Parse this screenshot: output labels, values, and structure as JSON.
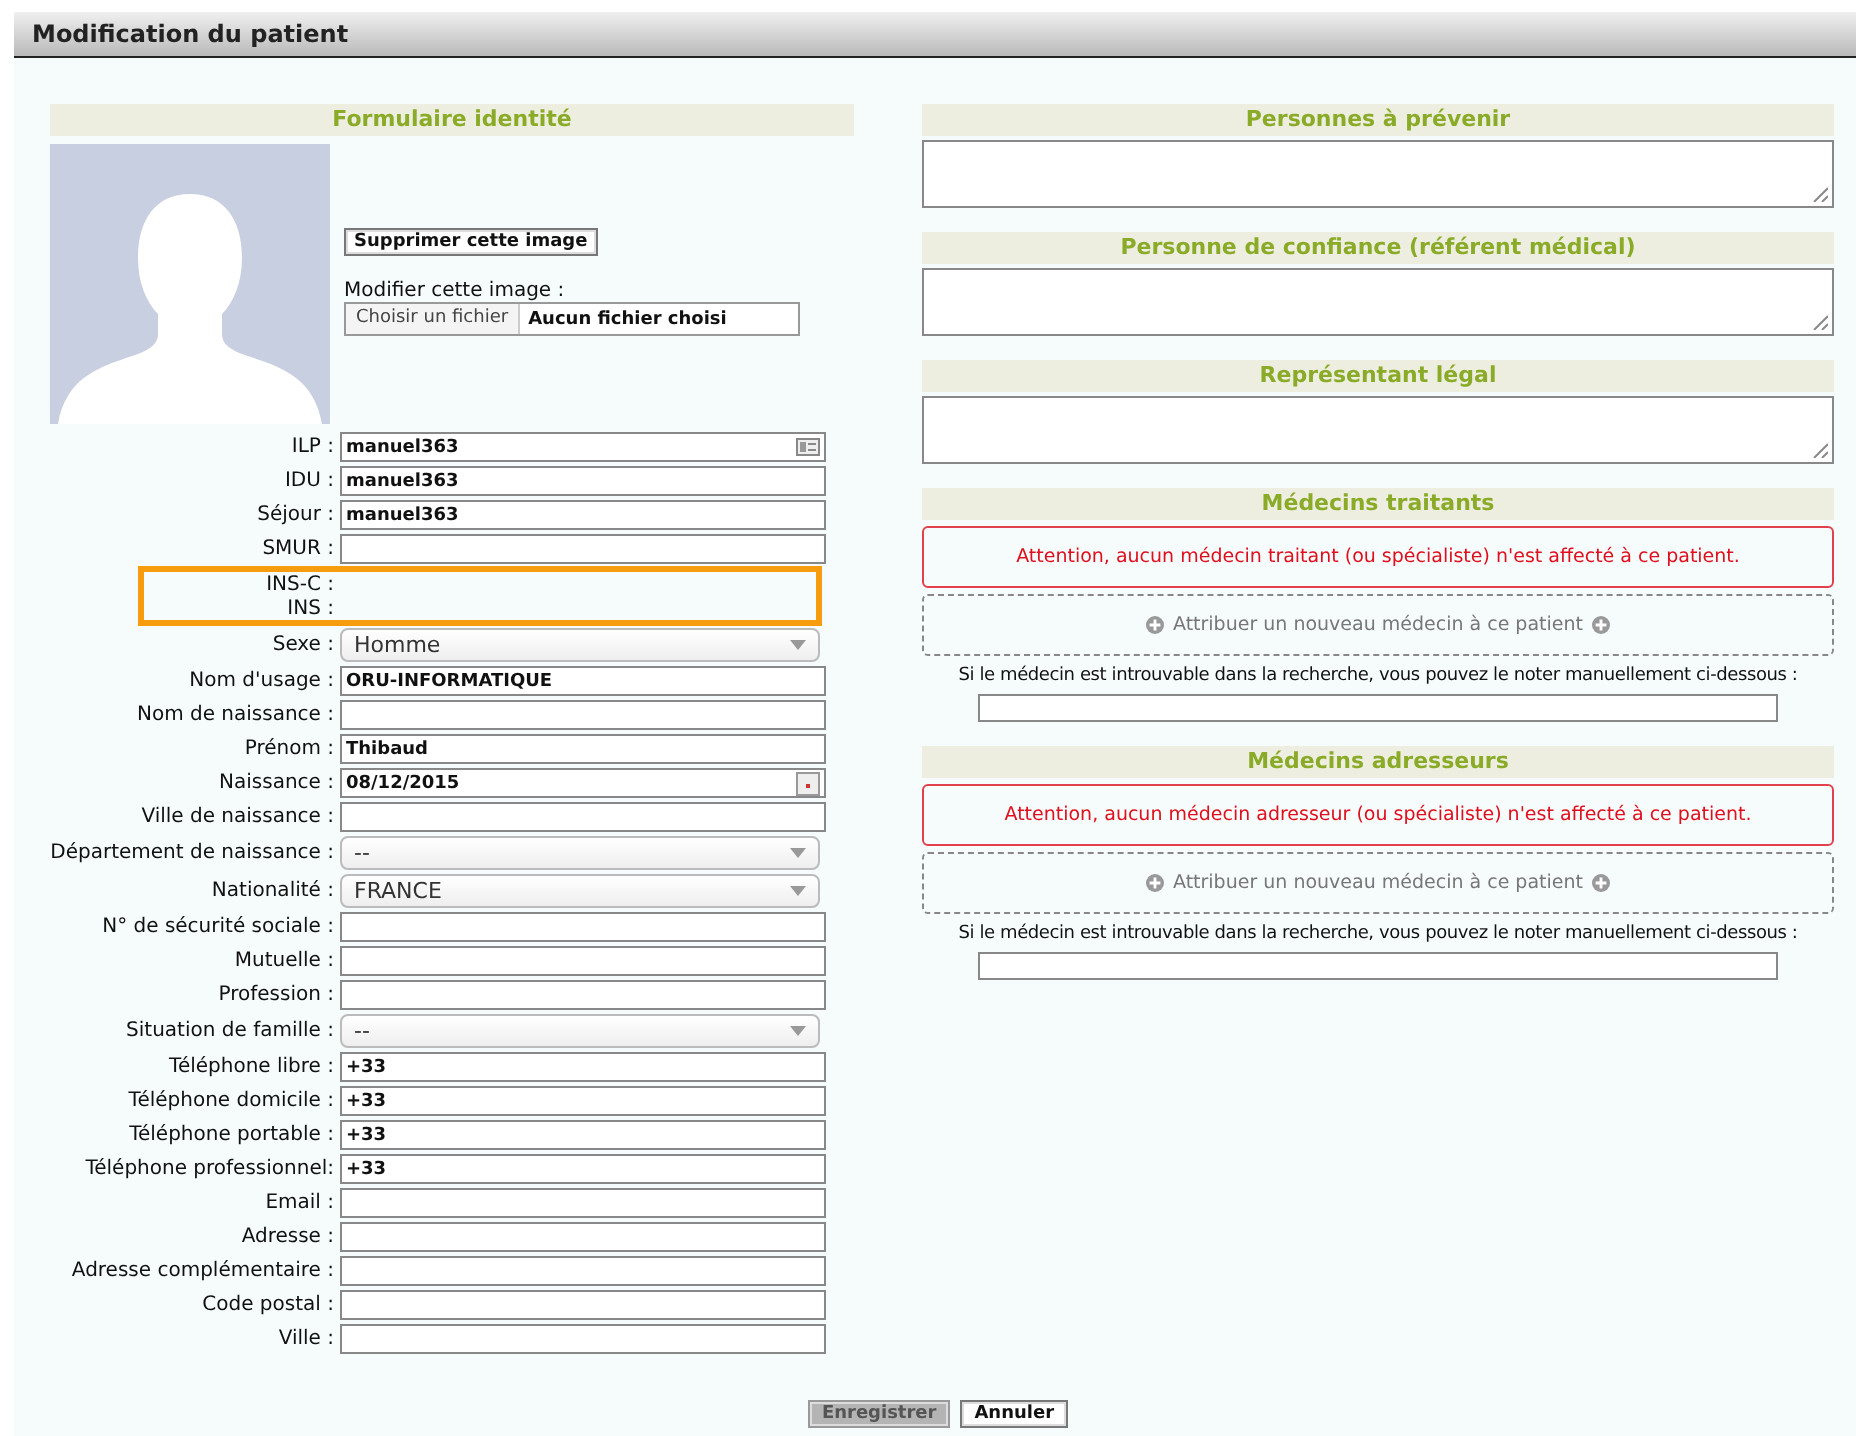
{
  "window": {
    "title": "Modification du patient"
  },
  "identity": {
    "header": "Formulaire identité",
    "photo": {
      "delete_button": "Supprimer cette image",
      "modify_label": "Modifier cette image :",
      "file_button": "Choisir un fichier",
      "file_status": "Aucun fichier choisi"
    },
    "fields": [
      {
        "label": "ILP :",
        "kind": "lookup",
        "value": "manuel363",
        "highlighted": false
      },
      {
        "label": "IDU :",
        "kind": "text",
        "value": "manuel363",
        "highlighted": false
      },
      {
        "label": "Séjour :",
        "kind": "text",
        "value": "manuel363",
        "highlighted": false
      },
      {
        "label": "SMUR :",
        "kind": "text",
        "highlighted": false
      },
      {
        "label": "INS-C :",
        "kind": "none",
        "highlighted": true
      },
      {
        "label": "INS :",
        "kind": "none",
        "highlighted": true
      },
      {
        "label": "Sexe :",
        "kind": "select",
        "value": "Homme",
        "highlighted": false
      },
      {
        "label": "Nom d'usage :",
        "kind": "text",
        "value": "ORU-INFORMATIQUE",
        "highlighted": false
      },
      {
        "label": "Nom de naissance :",
        "kind": "text",
        "highlighted": false
      },
      {
        "label": "Prénom :",
        "kind": "text",
        "value": "Thibaud",
        "highlighted": false
      },
      {
        "label": "Naissance :",
        "kind": "date",
        "value": "08/12/2015",
        "highlighted": false
      },
      {
        "label": "Ville de naissance :",
        "kind": "text",
        "highlighted": false
      },
      {
        "label": "Département de naissance :",
        "kind": "select",
        "value": "--",
        "highlighted": false
      },
      {
        "label": "Nationalité :",
        "kind": "select",
        "value": "FRANCE",
        "highlighted": false
      },
      {
        "label": "N° de sécurité sociale :",
        "kind": "text",
        "highlighted": false
      },
      {
        "label": "Mutuelle :",
        "kind": "text",
        "highlighted": false
      },
      {
        "label": "Profession :",
        "kind": "text",
        "highlighted": false
      },
      {
        "label": "Situation de famille :",
        "kind": "select",
        "value": "--",
        "highlighted": false
      },
      {
        "label": "Téléphone libre :",
        "kind": "text",
        "value": "+33",
        "highlighted": false
      },
      {
        "label": "Téléphone domicile :",
        "kind": "text",
        "value": "+33",
        "highlighted": false
      },
      {
        "label": "Téléphone portable :",
        "kind": "text",
        "value": "+33",
        "highlighted": false
      },
      {
        "label": "Téléphone professionnel:",
        "kind": "text",
        "value": "+33",
        "highlighted": false
      },
      {
        "label": "Email :",
        "kind": "text",
        "highlighted": false
      },
      {
        "label": "Adresse :",
        "kind": "text",
        "highlighted": false
      },
      {
        "label": "Adresse complémentaire :",
        "kind": "text",
        "highlighted": false
      },
      {
        "label": "Code postal :",
        "kind": "text",
        "highlighted": false
      },
      {
        "label": "Ville :",
        "kind": "text",
        "highlighted": false
      }
    ]
  },
  "contacts": [
    {
      "header": "Personnes à prévenir"
    },
    {
      "header": "Personne de confiance (référent médical)"
    },
    {
      "header": "Représentant légal"
    }
  ],
  "doctors": [
    {
      "header": "Médecins traitants",
      "warning": "Attention, aucun médecin traitant (ou spécialiste) n'est affecté à ce patient.",
      "assign_link": "Attribuer un nouveau médecin à ce patient",
      "manual_note": "Si le médecin est introuvable dans la recherche, vous pouvez le noter manuellement ci-dessous :"
    },
    {
      "header": "Médecins adresseurs",
      "warning": "Attention, aucun médecin adresseur (ou spécialiste) n'est affecté à ce patient.",
      "assign_link": "Attribuer un nouveau médecin à ce patient",
      "manual_note": "Si le médecin est introuvable dans la recherche, vous pouvez le noter manuellement ci-dessous :"
    }
  ],
  "buttons": [
    {
      "label": "Enregistrer",
      "disabled": true
    },
    {
      "label": "Annuler",
      "disabled": false
    }
  ]
}
